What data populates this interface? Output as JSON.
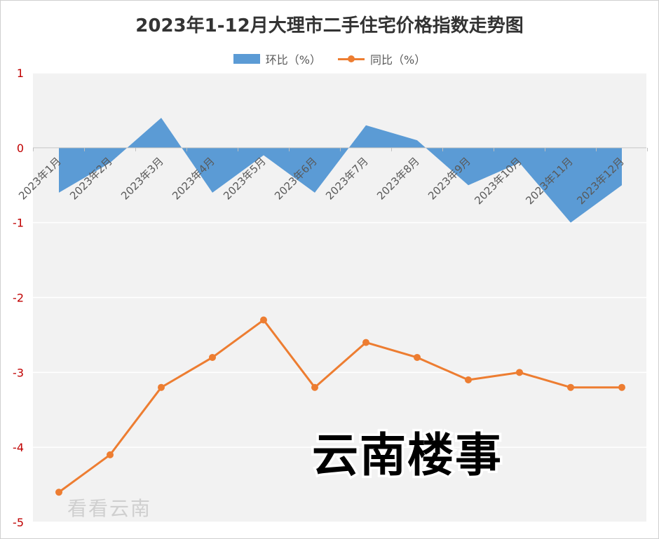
{
  "chart_data": {
    "type": "line",
    "title": "2023年1-12月大理市二手住宅价格指数走势图",
    "categories": [
      "2023年1月",
      "2023年2月",
      "2023年3月",
      "2023年4月",
      "2023年5月",
      "2023年6月",
      "2023年7月",
      "2023年8月",
      "2023年9月",
      "2023年10月",
      "2023年11月",
      "2023年12月"
    ],
    "series": [
      {
        "name": "环比（%）",
        "type": "area",
        "color": "#5b9bd5",
        "values": [
          -0.6,
          -0.2,
          0.4,
          -0.6,
          -0.1,
          -0.6,
          0.3,
          0.1,
          -0.5,
          -0.2,
          -1.0,
          -0.5
        ]
      },
      {
        "name": "同比（%）",
        "type": "line",
        "color": "#ed7d31",
        "values": [
          -4.6,
          -4.1,
          -3.2,
          -2.8,
          -2.3,
          -3.2,
          -2.6,
          -2.8,
          -3.1,
          -3.0,
          -3.2,
          -3.2
        ]
      }
    ],
    "ylim": [
      -5,
      1
    ],
    "yticks": [
      "1",
      "0",
      "-1",
      "-2",
      "-3",
      "-4",
      "-5"
    ],
    "ytick_color": "#c00000",
    "grid": true,
    "plot_background": "#f2f2f2",
    "legend": "top"
  },
  "watermark": "云南楼事",
  "logo": "看看云南"
}
